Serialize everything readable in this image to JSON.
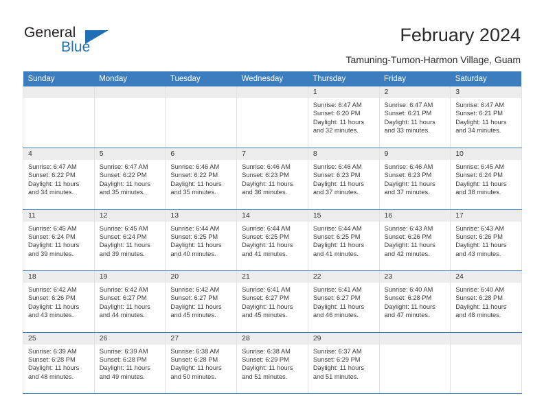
{
  "brand": {
    "name_part1": "General",
    "name_part2": "Blue",
    "accent_color": "#1f6fb6"
  },
  "header": {
    "title": "February 2024",
    "subtitle": "Tamuning-Tumon-Harmon Village, Guam"
  },
  "theme": {
    "header_bar_color": "#3b7dbf",
    "daynum_band_color": "#ededed",
    "row_separator_color": "#3b7dbf"
  },
  "calendar": {
    "weekday_headers": [
      "Sunday",
      "Monday",
      "Tuesday",
      "Wednesday",
      "Thursday",
      "Friday",
      "Saturday"
    ],
    "weeks": [
      [
        {
          "day": "",
          "empty": true,
          "sunrise": "",
          "sunset": "",
          "daylight_line1": "",
          "daylight_line2": ""
        },
        {
          "day": "",
          "empty": true,
          "sunrise": "",
          "sunset": "",
          "daylight_line1": "",
          "daylight_line2": ""
        },
        {
          "day": "",
          "empty": true,
          "sunrise": "",
          "sunset": "",
          "daylight_line1": "",
          "daylight_line2": ""
        },
        {
          "day": "",
          "empty": true,
          "sunrise": "",
          "sunset": "",
          "daylight_line1": "",
          "daylight_line2": ""
        },
        {
          "day": "1",
          "empty": false,
          "sunrise": "Sunrise: 6:47 AM",
          "sunset": "Sunset: 6:20 PM",
          "daylight_line1": "Daylight: 11 hours",
          "daylight_line2": "and 32 minutes."
        },
        {
          "day": "2",
          "empty": false,
          "sunrise": "Sunrise: 6:47 AM",
          "sunset": "Sunset: 6:21 PM",
          "daylight_line1": "Daylight: 11 hours",
          "daylight_line2": "and 33 minutes."
        },
        {
          "day": "3",
          "empty": false,
          "sunrise": "Sunrise: 6:47 AM",
          "sunset": "Sunset: 6:21 PM",
          "daylight_line1": "Daylight: 11 hours",
          "daylight_line2": "and 34 minutes."
        }
      ],
      [
        {
          "day": "4",
          "empty": false,
          "sunrise": "Sunrise: 6:47 AM",
          "sunset": "Sunset: 6:22 PM",
          "daylight_line1": "Daylight: 11 hours",
          "daylight_line2": "and 34 minutes."
        },
        {
          "day": "5",
          "empty": false,
          "sunrise": "Sunrise: 6:47 AM",
          "sunset": "Sunset: 6:22 PM",
          "daylight_line1": "Daylight: 11 hours",
          "daylight_line2": "and 35 minutes."
        },
        {
          "day": "6",
          "empty": false,
          "sunrise": "Sunrise: 6:46 AM",
          "sunset": "Sunset: 6:22 PM",
          "daylight_line1": "Daylight: 11 hours",
          "daylight_line2": "and 35 minutes."
        },
        {
          "day": "7",
          "empty": false,
          "sunrise": "Sunrise: 6:46 AM",
          "sunset": "Sunset: 6:23 PM",
          "daylight_line1": "Daylight: 11 hours",
          "daylight_line2": "and 36 minutes."
        },
        {
          "day": "8",
          "empty": false,
          "sunrise": "Sunrise: 6:46 AM",
          "sunset": "Sunset: 6:23 PM",
          "daylight_line1": "Daylight: 11 hours",
          "daylight_line2": "and 37 minutes."
        },
        {
          "day": "9",
          "empty": false,
          "sunrise": "Sunrise: 6:46 AM",
          "sunset": "Sunset: 6:23 PM",
          "daylight_line1": "Daylight: 11 hours",
          "daylight_line2": "and 37 minutes."
        },
        {
          "day": "10",
          "empty": false,
          "sunrise": "Sunrise: 6:45 AM",
          "sunset": "Sunset: 6:24 PM",
          "daylight_line1": "Daylight: 11 hours",
          "daylight_line2": "and 38 minutes."
        }
      ],
      [
        {
          "day": "11",
          "empty": false,
          "sunrise": "Sunrise: 6:45 AM",
          "sunset": "Sunset: 6:24 PM",
          "daylight_line1": "Daylight: 11 hours",
          "daylight_line2": "and 39 minutes."
        },
        {
          "day": "12",
          "empty": false,
          "sunrise": "Sunrise: 6:45 AM",
          "sunset": "Sunset: 6:24 PM",
          "daylight_line1": "Daylight: 11 hours",
          "daylight_line2": "and 39 minutes."
        },
        {
          "day": "13",
          "empty": false,
          "sunrise": "Sunrise: 6:44 AM",
          "sunset": "Sunset: 6:25 PM",
          "daylight_line1": "Daylight: 11 hours",
          "daylight_line2": "and 40 minutes."
        },
        {
          "day": "14",
          "empty": false,
          "sunrise": "Sunrise: 6:44 AM",
          "sunset": "Sunset: 6:25 PM",
          "daylight_line1": "Daylight: 11 hours",
          "daylight_line2": "and 41 minutes."
        },
        {
          "day": "15",
          "empty": false,
          "sunrise": "Sunrise: 6:44 AM",
          "sunset": "Sunset: 6:25 PM",
          "daylight_line1": "Daylight: 11 hours",
          "daylight_line2": "and 41 minutes."
        },
        {
          "day": "16",
          "empty": false,
          "sunrise": "Sunrise: 6:43 AM",
          "sunset": "Sunset: 6:26 PM",
          "daylight_line1": "Daylight: 11 hours",
          "daylight_line2": "and 42 minutes."
        },
        {
          "day": "17",
          "empty": false,
          "sunrise": "Sunrise: 6:43 AM",
          "sunset": "Sunset: 6:26 PM",
          "daylight_line1": "Daylight: 11 hours",
          "daylight_line2": "and 43 minutes."
        }
      ],
      [
        {
          "day": "18",
          "empty": false,
          "sunrise": "Sunrise: 6:42 AM",
          "sunset": "Sunset: 6:26 PM",
          "daylight_line1": "Daylight: 11 hours",
          "daylight_line2": "and 43 minutes."
        },
        {
          "day": "19",
          "empty": false,
          "sunrise": "Sunrise: 6:42 AM",
          "sunset": "Sunset: 6:27 PM",
          "daylight_line1": "Daylight: 11 hours",
          "daylight_line2": "and 44 minutes."
        },
        {
          "day": "20",
          "empty": false,
          "sunrise": "Sunrise: 6:42 AM",
          "sunset": "Sunset: 6:27 PM",
          "daylight_line1": "Daylight: 11 hours",
          "daylight_line2": "and 45 minutes."
        },
        {
          "day": "21",
          "empty": false,
          "sunrise": "Sunrise: 6:41 AM",
          "sunset": "Sunset: 6:27 PM",
          "daylight_line1": "Daylight: 11 hours",
          "daylight_line2": "and 45 minutes."
        },
        {
          "day": "22",
          "empty": false,
          "sunrise": "Sunrise: 6:41 AM",
          "sunset": "Sunset: 6:27 PM",
          "daylight_line1": "Daylight: 11 hours",
          "daylight_line2": "and 46 minutes."
        },
        {
          "day": "23",
          "empty": false,
          "sunrise": "Sunrise: 6:40 AM",
          "sunset": "Sunset: 6:28 PM",
          "daylight_line1": "Daylight: 11 hours",
          "daylight_line2": "and 47 minutes."
        },
        {
          "day": "24",
          "empty": false,
          "sunrise": "Sunrise: 6:40 AM",
          "sunset": "Sunset: 6:28 PM",
          "daylight_line1": "Daylight: 11 hours",
          "daylight_line2": "and 48 minutes."
        }
      ],
      [
        {
          "day": "25",
          "empty": false,
          "sunrise": "Sunrise: 6:39 AM",
          "sunset": "Sunset: 6:28 PM",
          "daylight_line1": "Daylight: 11 hours",
          "daylight_line2": "and 48 minutes."
        },
        {
          "day": "26",
          "empty": false,
          "sunrise": "Sunrise: 6:39 AM",
          "sunset": "Sunset: 6:28 PM",
          "daylight_line1": "Daylight: 11 hours",
          "daylight_line2": "and 49 minutes."
        },
        {
          "day": "27",
          "empty": false,
          "sunrise": "Sunrise: 6:38 AM",
          "sunset": "Sunset: 6:28 PM",
          "daylight_line1": "Daylight: 11 hours",
          "daylight_line2": "and 50 minutes."
        },
        {
          "day": "28",
          "empty": false,
          "sunrise": "Sunrise: 6:38 AM",
          "sunset": "Sunset: 6:29 PM",
          "daylight_line1": "Daylight: 11 hours",
          "daylight_line2": "and 51 minutes."
        },
        {
          "day": "29",
          "empty": false,
          "sunrise": "Sunrise: 6:37 AM",
          "sunset": "Sunset: 6:29 PM",
          "daylight_line1": "Daylight: 11 hours",
          "daylight_line2": "and 51 minutes."
        },
        {
          "day": "",
          "empty": true,
          "sunrise": "",
          "sunset": "",
          "daylight_line1": "",
          "daylight_line2": ""
        },
        {
          "day": "",
          "empty": true,
          "sunrise": "",
          "sunset": "",
          "daylight_line1": "",
          "daylight_line2": ""
        }
      ]
    ]
  }
}
